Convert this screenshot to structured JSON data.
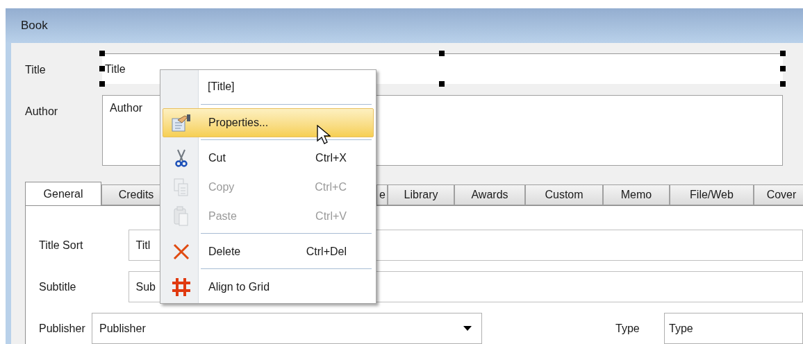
{
  "window": {
    "title": "Book"
  },
  "fields": [
    {
      "label": "Title",
      "value": "Title",
      "kind": "selected-line"
    },
    {
      "label": "Author",
      "value": "Author",
      "kind": "multiline"
    }
  ],
  "tabs": [
    {
      "label": "General",
      "selected": true
    },
    {
      "label": "Credits",
      "selected": false
    },
    {
      "label": "e",
      "selected": false
    },
    {
      "label": "Library",
      "selected": false
    },
    {
      "label": "Awards",
      "selected": false
    },
    {
      "label": "Custom",
      "selected": false
    },
    {
      "label": "Memo",
      "selected": false
    },
    {
      "label": "File/Web",
      "selected": false
    },
    {
      "label": "Cover",
      "selected": false
    }
  ],
  "general_fields": [
    {
      "label": "Title Sort",
      "value": "Titl",
      "kind": "text"
    },
    {
      "label": "Subtitle",
      "value": "Sub",
      "kind": "text"
    },
    {
      "label": "Publisher",
      "value": "Publisher",
      "kind": "dropdown"
    }
  ],
  "type_field": {
    "label": "Type",
    "value": "Type"
  },
  "context_menu": {
    "items": [
      {
        "kind": "header",
        "label": "[Title]"
      },
      {
        "kind": "separator"
      },
      {
        "kind": "properties",
        "label": "Properties...",
        "selected": true,
        "disabled": false
      },
      {
        "kind": "separator"
      },
      {
        "kind": "cut",
        "label": "Cut",
        "shortcut": "Ctrl+X",
        "selected": false,
        "disabled": false
      },
      {
        "kind": "copy",
        "label": "Copy",
        "shortcut": "Ctrl+C",
        "selected": false,
        "disabled": true
      },
      {
        "kind": "paste",
        "label": "Paste",
        "shortcut": "Ctrl+V",
        "selected": false,
        "disabled": true
      },
      {
        "kind": "separator"
      },
      {
        "kind": "delete",
        "label": "Delete",
        "shortcut": "Ctrl+Del",
        "selected": false,
        "disabled": false
      },
      {
        "kind": "separator"
      },
      {
        "kind": "grid",
        "label": "Align to Grid",
        "selected": false,
        "disabled": false
      }
    ]
  }
}
